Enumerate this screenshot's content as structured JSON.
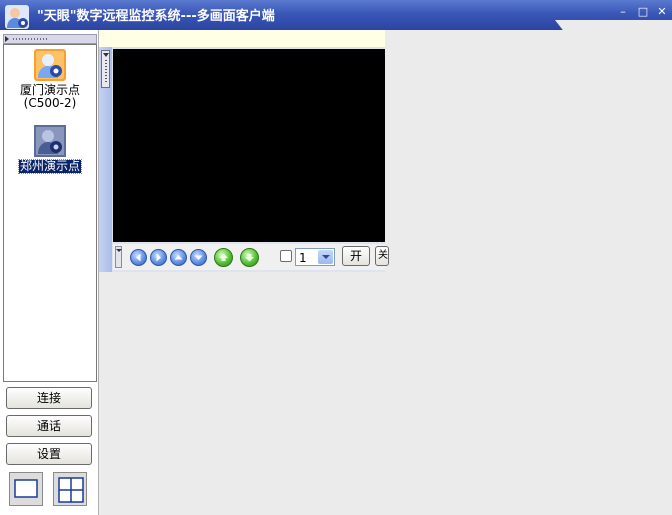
{
  "window": {
    "title": "\"天眼\"数字远程监控系统---多画面客户端",
    "minimize_label": "–",
    "maximize_label": "□",
    "close_label": "✕"
  },
  "site_list": {
    "items": [
      {
        "label_line1": "厦门演示点",
        "label_line2": "(C500-2)",
        "icon": "camera-site-icon",
        "selected": false
      },
      {
        "label_line1": "郑州演示点",
        "icon": "camera-site-icon",
        "selected": true
      }
    ]
  },
  "buttons": {
    "connect": "连接",
    "talk": "通话",
    "settings": "设置"
  },
  "layouts": [
    {
      "name": "single-view",
      "icon": "single-view-icon"
    },
    {
      "name": "quad-view",
      "icon": "quad-view-icon"
    }
  ],
  "video_controls": {
    "channel_value": "1",
    "open_label": "开",
    "next_label": "关",
    "buttons": [
      "arrow-left-icon",
      "arrow-right-icon",
      "arrow-up-icon",
      "arrow-down-icon",
      "zoom-in-icon",
      "zoom-out-icon"
    ]
  },
  "colors": {
    "titlebar": "#3a57b8",
    "selection": "#0a246a",
    "video": "#000000"
  }
}
